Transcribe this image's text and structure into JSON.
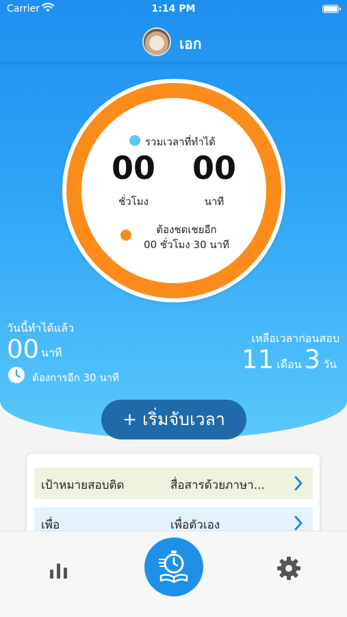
{
  "status_bar": {
    "carrier": "Carrier",
    "time": "1:14 PM"
  },
  "header": {
    "user_name": "เอก"
  },
  "ring": {
    "total_label": "รวมเวลาที่ทำได้",
    "hours": "00",
    "minutes": "00",
    "hours_unit": "ชั่วโมง",
    "minutes_unit": "นาที",
    "owe_label": "ต้องชดเชยอีก",
    "owe_value": "00 ชั่วโมง 30 นาที"
  },
  "today": {
    "label": "วันนี้ทำได้แล้ว",
    "value": "00",
    "unit": "นาที",
    "need_more": "ต้องการอีก 30 นาที"
  },
  "remaining": {
    "label": "เหลือเวลาก่อนสอบ",
    "months": "11",
    "months_unit": "เดือน",
    "days": "3",
    "days_unit": "วัน"
  },
  "start_button": {
    "label": "+ เริ่มจับเวลา"
  },
  "goal_card": {
    "rows": [
      {
        "key": "เป้าหมายสอบติด",
        "value": "สื่อสารด้วยภาษา..."
      },
      {
        "key": "เพื่อ",
        "value": "เพื่อตัวเอง"
      }
    ]
  },
  "colors": {
    "header_blue": "#1e90f0",
    "ring_orange": "#fb8c1c",
    "legend_blue": "#5ac8fb",
    "start_button": "#1f6aa8",
    "chevron": "#1e88e5"
  },
  "icons": [
    "wifi-icon",
    "battery-icon",
    "clock-icon",
    "chevron-right-icon",
    "bar-chart-icon",
    "stopwatch-book-icon",
    "gear-icon"
  ]
}
